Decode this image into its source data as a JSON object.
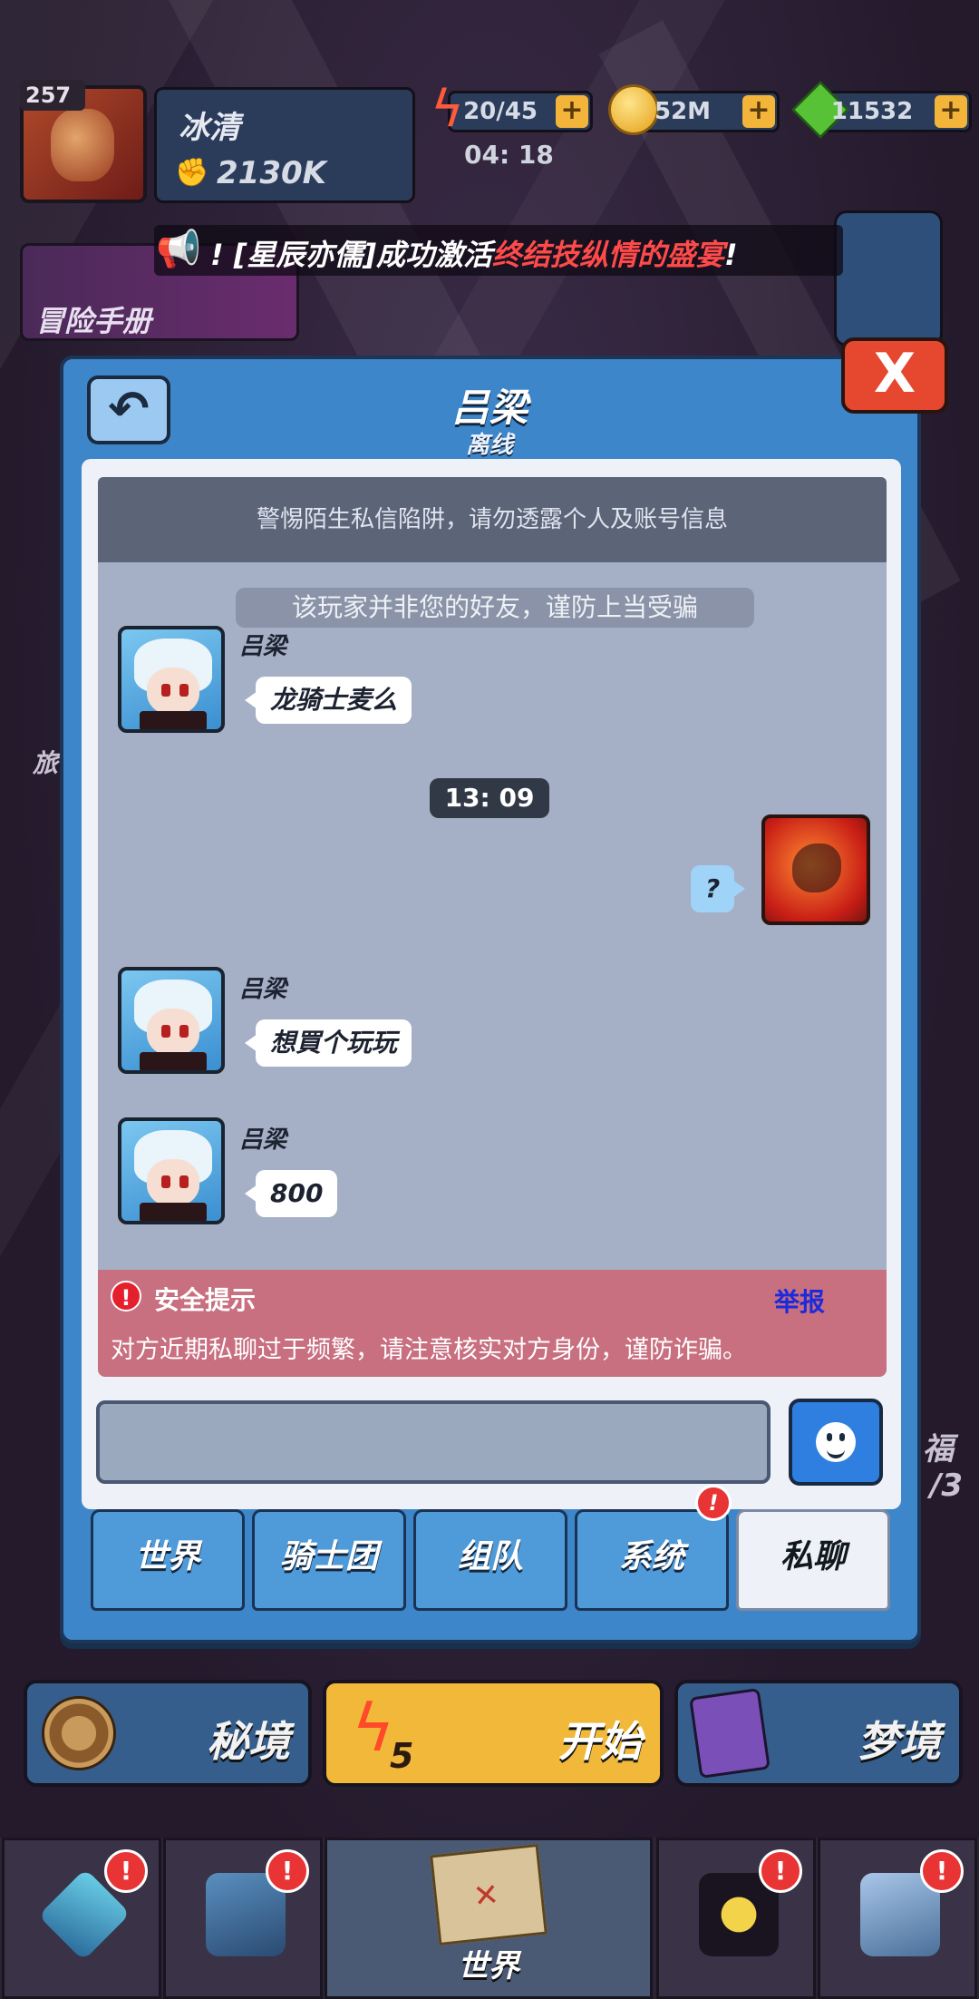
{
  "player": {
    "level": "257",
    "name": "冰清",
    "power": "2130K"
  },
  "resources": {
    "energy": "20/45",
    "energy_timer": "04: 18",
    "coins": "52M",
    "gems": "11532",
    "plus": "+"
  },
  "announcement": {
    "prefix": "! [星辰亦儒]成功激活",
    "highlight": "终结技纵情的盛宴",
    "suffix": "!"
  },
  "adventure_handbook": "冒险手册",
  "chat": {
    "contact_name": "吕梁",
    "contact_status": "离线",
    "close_label": "X",
    "warning_banner": "警惕陌生私信陷阱，请勿透露个人及账号信息",
    "system_notice": "该玩家并非您的好友，谨防上当受骗",
    "time_divider": "13: 09",
    "messages": [
      {
        "sender": "吕梁",
        "text": "龙骑士麦么"
      },
      {
        "sender": "me",
        "text": "?"
      },
      {
        "sender": "吕梁",
        "text": "想買个玩玩"
      },
      {
        "sender": "吕梁",
        "text": "800"
      }
    ],
    "safety": {
      "title": "安全提示",
      "report": "举报",
      "text": "对方近期私聊过于频繁，请注意核实对方身份，谨防诈骗。",
      "icon": "!"
    },
    "input_placeholder": "",
    "tabs": [
      {
        "label": "世界"
      },
      {
        "label": "骑士团"
      },
      {
        "label": "组队"
      },
      {
        "label": "系统",
        "badge": "!"
      },
      {
        "label": "私聊"
      }
    ]
  },
  "game_buttons": {
    "secret": "秘境",
    "start": "开始",
    "start_cost": "5",
    "dream": "梦境"
  },
  "side_hints": {
    "right_1": "福",
    "right_2": "/3",
    "left_1": "旅"
  },
  "bottom_nav": [
    {
      "label": "",
      "badge": "!"
    },
    {
      "label": "",
      "badge": "!"
    },
    {
      "label": "世界"
    },
    {
      "label": "",
      "badge": "!"
    },
    {
      "label": "",
      "badge": "!"
    }
  ],
  "colors": {
    "panel_blue": "#3d86c9",
    "close_red": "#e6472f",
    "safety_pink": "#c86f80",
    "report_blue": "#1b2bdc",
    "announce_highlight": "#ff4a4a"
  }
}
